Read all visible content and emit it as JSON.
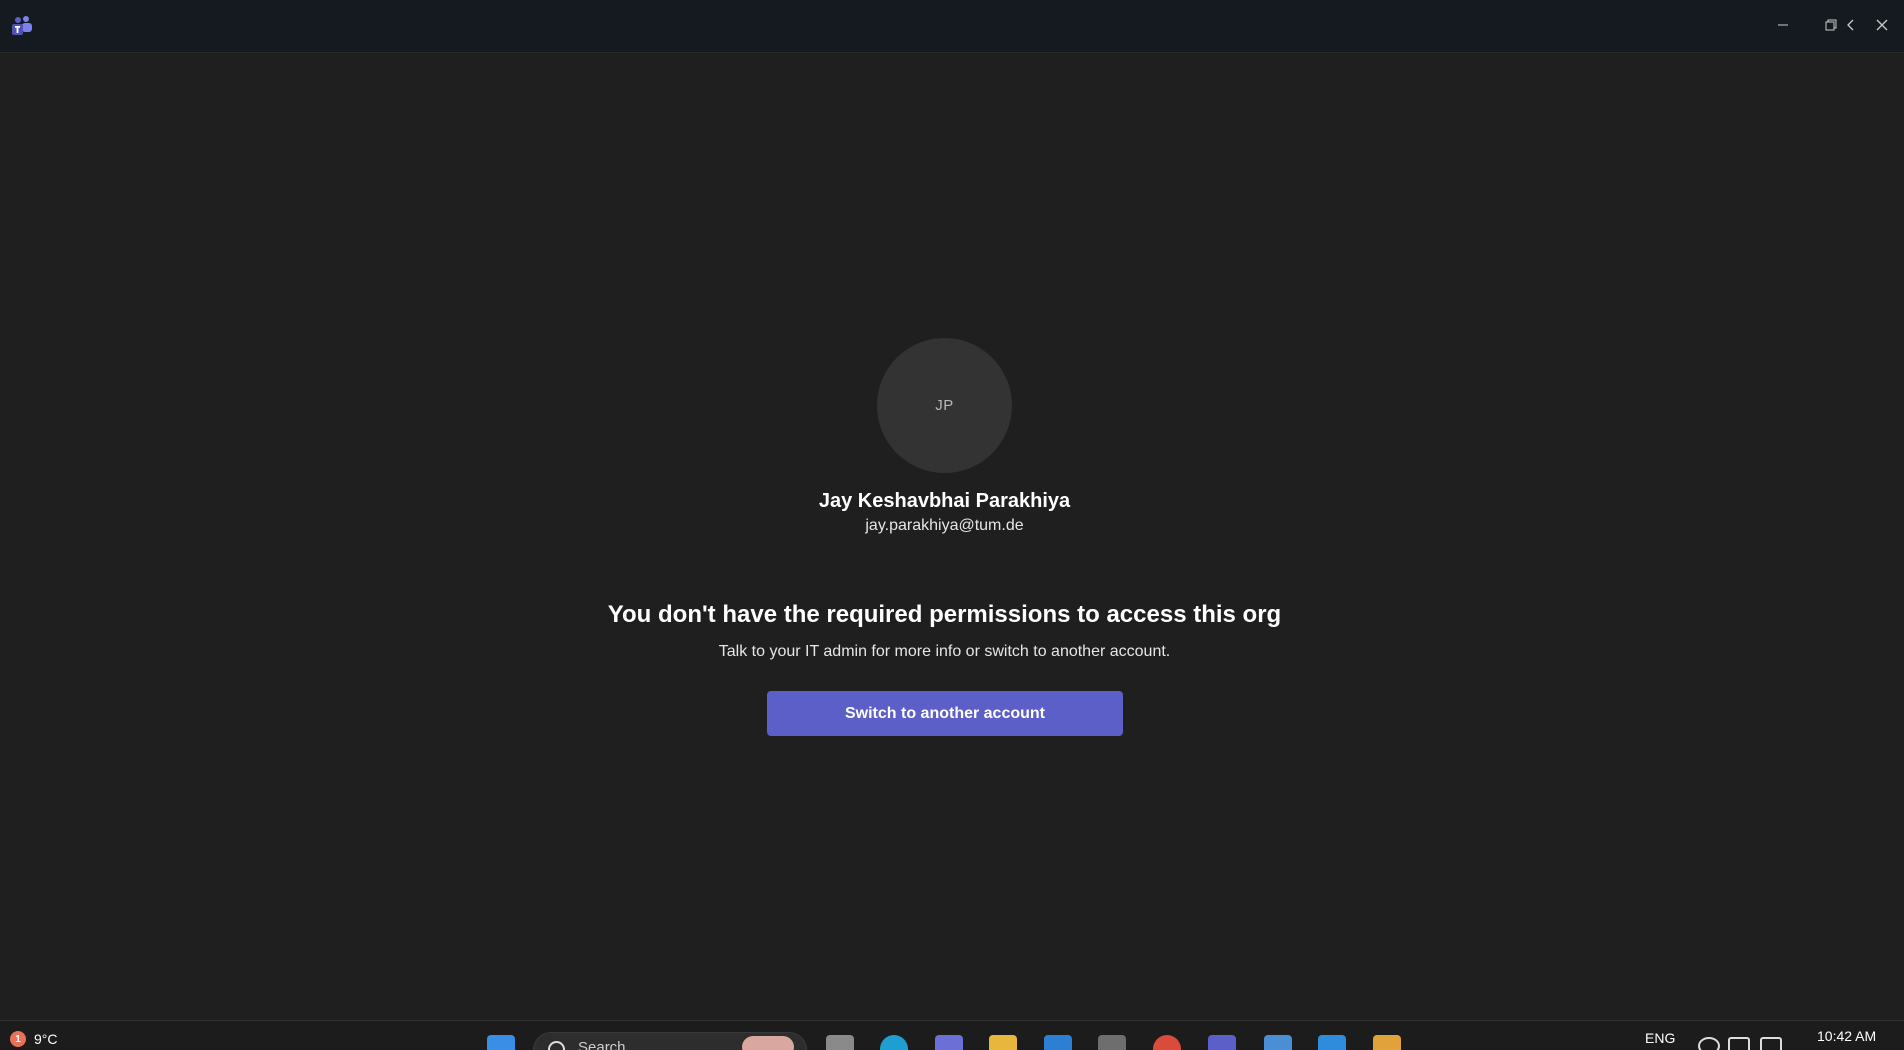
{
  "titlebar": {
    "app_icon": "teams-icon",
    "controls": [
      "minimize-icon",
      "restore-icon",
      "back-icon",
      "close-icon"
    ]
  },
  "account": {
    "initials": "JP",
    "name": "Jay Keshavbhai Parakhiya",
    "email": "jay.parakhiya@tum.de"
  },
  "message": {
    "heading": "You don't have the required permissions to access this org",
    "subtext": "Talk to your IT admin for more info or switch to another account."
  },
  "actions": {
    "switch_account_label": "Switch to another account"
  },
  "taskbar": {
    "weather_badge": "1",
    "weather_temp": "9°C",
    "search_placeholder": "Search",
    "language": "ENG",
    "time": "10:42 AM",
    "pinned_apps": [
      "start-icon",
      "file-icon",
      "edge-icon",
      "teams-icon",
      "file-explorer-icon",
      "store-icon",
      "security-icon",
      "chrome-icon",
      "teams-alert-icon",
      "notepad-icon",
      "vscode-icon",
      "launcher-icon"
    ]
  },
  "colors": {
    "background": "#1f1f1f",
    "titlebar": "#141a1f",
    "accent": "#5b5fc7",
    "avatar": "#333333"
  }
}
